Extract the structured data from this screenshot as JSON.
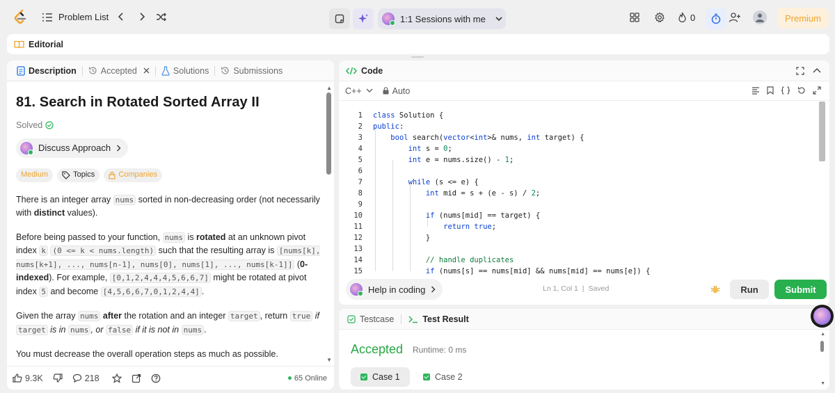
{
  "topbar": {
    "problem_list_label": "Problem List",
    "sessions_label": "1:1 Sessions with me",
    "fire_count": "0",
    "premium_label": "Premium"
  },
  "editorial": {
    "label": "Editorial"
  },
  "left_tabs": {
    "description": "Description",
    "accepted": "Accepted",
    "solutions": "Solutions",
    "submissions": "Submissions"
  },
  "problem": {
    "title": "81. Search in Rotated Sorted Array II",
    "solved_label": "Solved",
    "discuss_label": "Discuss Approach",
    "chips": {
      "difficulty": "Medium",
      "topics": "Topics",
      "companies": "Companies"
    },
    "p1": {
      "a": "There is an integer array ",
      "c1": "nums",
      "b": " sorted in non-decreasing order (not necessarily with ",
      "bold": "distinct",
      "d": " values)."
    },
    "p2": {
      "a": "Before being passed to your function, ",
      "c1": "nums",
      "b": " is ",
      "bold1": "rotated",
      "c": " at an unknown pivot index ",
      "c2": "k",
      "d": " ",
      "c3": "(0 <= k < nums.length)",
      "e": " such that the resulting array is ",
      "c4": "[nums[k], nums[k+1], ..., nums[n-1], nums[0], nums[1], ..., nums[k-1]]",
      "f": " (",
      "bold2": "0-indexed",
      "g": "). For example, ",
      "c5": "[0,1,2,4,4,4,5,6,6,7]",
      "h": " might be rotated at pivot index ",
      "c6": "5",
      "i": " and become ",
      "c7": "[4,5,6,6,7,0,1,2,4,4]",
      "j": "."
    },
    "p3": {
      "a": "Given the array ",
      "c1": "nums",
      "b": " ",
      "bold": "after",
      "c": " the rotation and an integer ",
      "c2": "target",
      "d": ", return ",
      "c3": "true",
      "e": " if ",
      "c4": "target",
      "f": " is in ",
      "c5": "nums",
      "g": ", or ",
      "c6": "false",
      "h": " if it is not in ",
      "c7": "nums",
      "i": "."
    },
    "p4": "You must decrease the overall operation steps as much as possible."
  },
  "left_footer": {
    "likes": "9.3K",
    "comments": "218",
    "online": "65 Online"
  },
  "code": {
    "header": "Code",
    "language": "C++",
    "mode": "Auto",
    "lines": [
      {
        "n": "1",
        "t": "class Solution {"
      },
      {
        "n": "2",
        "t": "public:"
      },
      {
        "n": "3",
        "t": "    bool search(vector<int>& nums, int target) {"
      },
      {
        "n": "4",
        "t": "        int s = 0;"
      },
      {
        "n": "5",
        "t": "        int e = nums.size() - 1;"
      },
      {
        "n": "6",
        "t": ""
      },
      {
        "n": "7",
        "t": "        while (s <= e) {"
      },
      {
        "n": "8",
        "t": "            int mid = s + (e - s) / 2;"
      },
      {
        "n": "9",
        "t": ""
      },
      {
        "n": "10",
        "t": "            if (nums[mid] == target) {"
      },
      {
        "n": "11",
        "t": "                return true;"
      },
      {
        "n": "12",
        "t": "            }"
      },
      {
        "n": "13",
        "t": ""
      },
      {
        "n": "14",
        "t": "            // handle duplicates"
      },
      {
        "n": "15",
        "t": "            if (nums[s] == nums[mid] && nums[mid] == nums[e]) {"
      }
    ],
    "help_label": "Help in coding",
    "cursor": "Ln 1, Col 1",
    "saved": "Saved",
    "run_label": "Run",
    "submit_label": "Submit"
  },
  "result": {
    "testcase_tab": "Testcase",
    "result_tab": "Test Result",
    "status": "Accepted",
    "runtime": "Runtime: 0 ms",
    "cases": [
      "Case 1",
      "Case 2"
    ]
  },
  "colors": {
    "accent_green": "#28b04f",
    "premium_orange": "#f0a42b",
    "keyword_blue": "#0a3fd1"
  }
}
